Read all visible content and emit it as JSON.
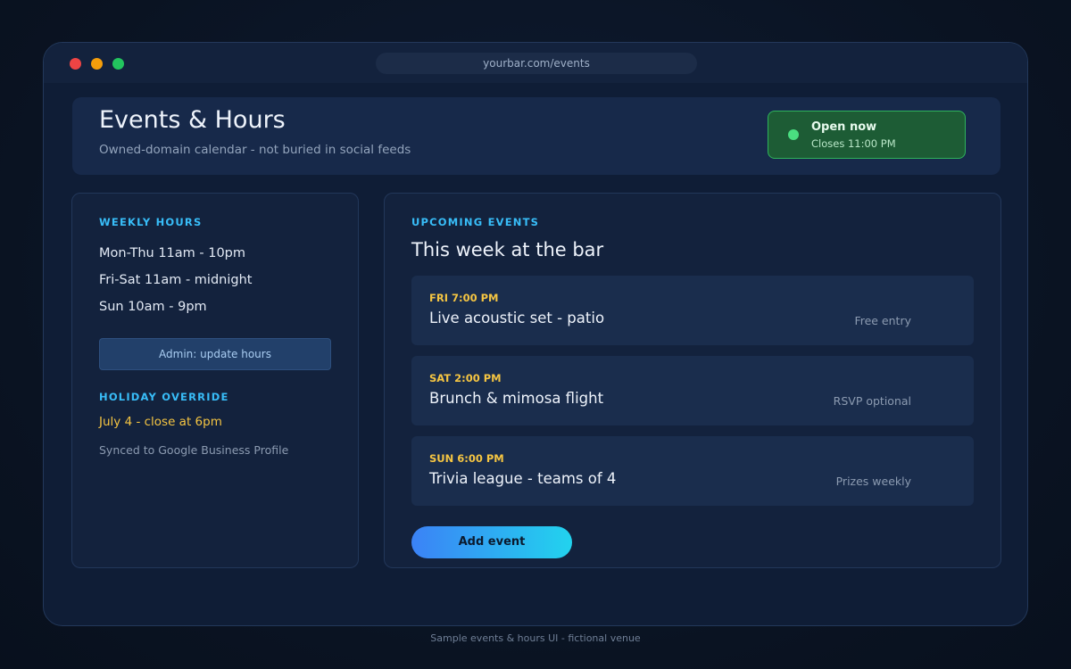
{
  "browser": {
    "url": "yourbar.com/events"
  },
  "header": {
    "title": "Events & Hours",
    "subtitle": "Owned-domain calendar - not buried in social feeds",
    "status": {
      "title": "Open now",
      "detail": "Closes 11:00 PM"
    }
  },
  "weekly_hours": {
    "label": "WEEKLY HOURS",
    "lines": [
      "Mon-Thu 11am - 10pm",
      "Fri-Sat 11am - midnight",
      "Sun 10am - 9pm"
    ],
    "admin_button": "Admin: update hours"
  },
  "holiday": {
    "label": "HOLIDAY OVERRIDE",
    "text": "July 4 - close at 6pm",
    "synced": "Synced to Google Business Profile"
  },
  "events": {
    "label": "UPCOMING EVENTS",
    "title": "This week at the bar",
    "items": [
      {
        "time": "FRI 7:00 PM",
        "title": "Live acoustic set - patio",
        "note": "Free entry"
      },
      {
        "time": "SAT 2:00 PM",
        "title": "Brunch & mimosa flight",
        "note": "RSVP optional"
      },
      {
        "time": "SUN 6:00 PM",
        "title": "Trivia league - teams of 4",
        "note": "Prizes weekly"
      }
    ],
    "add_button": "Add event"
  },
  "footer": "Sample events & hours UI - fictional venue",
  "colors": {
    "accent": "#38bdf8",
    "event_time": "#f5c542",
    "status_bg": "#1d5c35",
    "status_dot": "#4ade80"
  }
}
